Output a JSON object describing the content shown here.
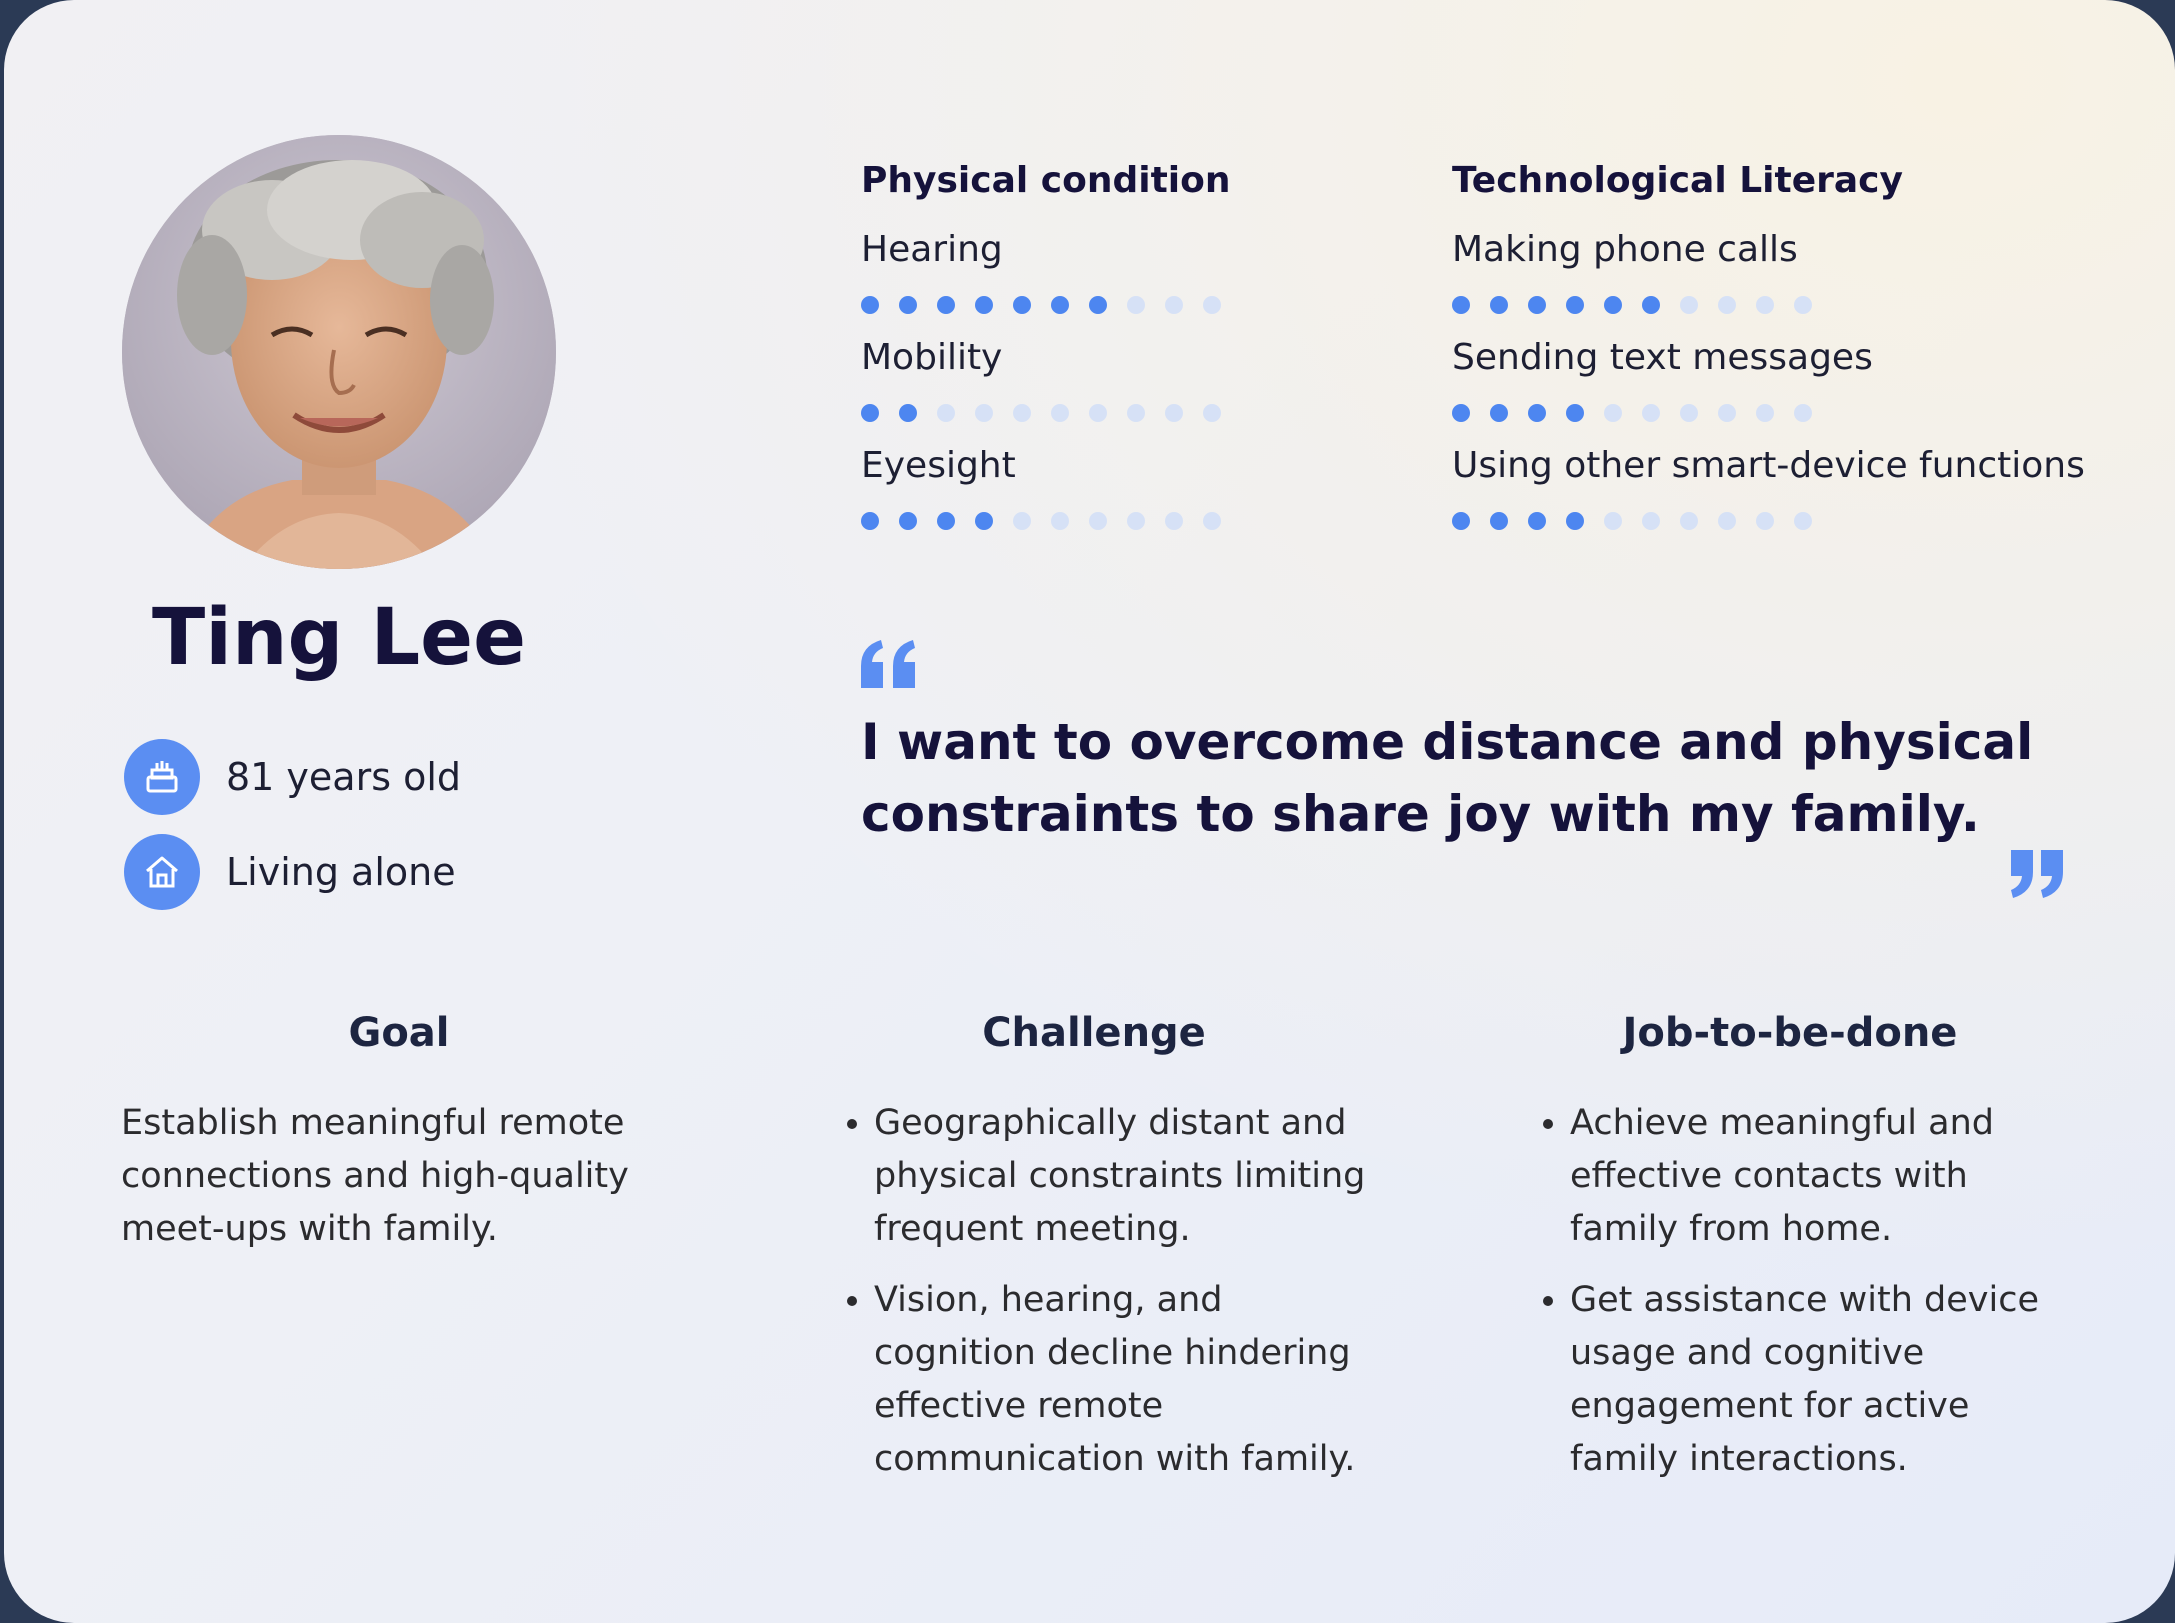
{
  "persona": {
    "name": "Ting Lee",
    "age": "81 years old",
    "living": "Living alone"
  },
  "physical": {
    "title": "Physical condition",
    "items": [
      {
        "label": "Hearing",
        "level": 7,
        "max": 10
      },
      {
        "label": "Mobility",
        "level": 2,
        "max": 10
      },
      {
        "label": "Eyesight",
        "level": 4,
        "max": 10
      }
    ]
  },
  "tech": {
    "title": "Technological Literacy",
    "items": [
      {
        "label": "Making phone calls",
        "level": 6,
        "max": 10
      },
      {
        "label": "Sending text messages",
        "level": 4,
        "max": 10
      },
      {
        "label": "Using other smart-device functions",
        "level": 4,
        "max": 10
      }
    ]
  },
  "quote": {
    "line1": "I want to overcome distance and physical",
    "line2": "constraints to share joy with my family."
  },
  "goal": {
    "title": "Goal",
    "text_lines": [
      "Establish meaningful remote",
      "connections and high-quality",
      "meet-ups with family."
    ]
  },
  "challenge": {
    "title": "Challenge",
    "items": [
      [
        "Geographically distant and",
        "physical constraints limiting",
        "frequent meeting."
      ],
      [
        "Vision, hearing, and",
        "cognition decline hindering",
        "effective remote",
        "communication with family."
      ]
    ]
  },
  "job": {
    "title": "Job-to-be-done",
    "items": [
      [
        "Achieve meaningful and",
        "effective contacts with",
        "family from home."
      ],
      [
        "Get assistance with device",
        "usage and cognitive",
        "engagement for active",
        "family interactions."
      ]
    ]
  },
  "colors": {
    "accent": "#4d86f0",
    "dot_off": "#d6e1f6",
    "heading": "#15123b"
  }
}
